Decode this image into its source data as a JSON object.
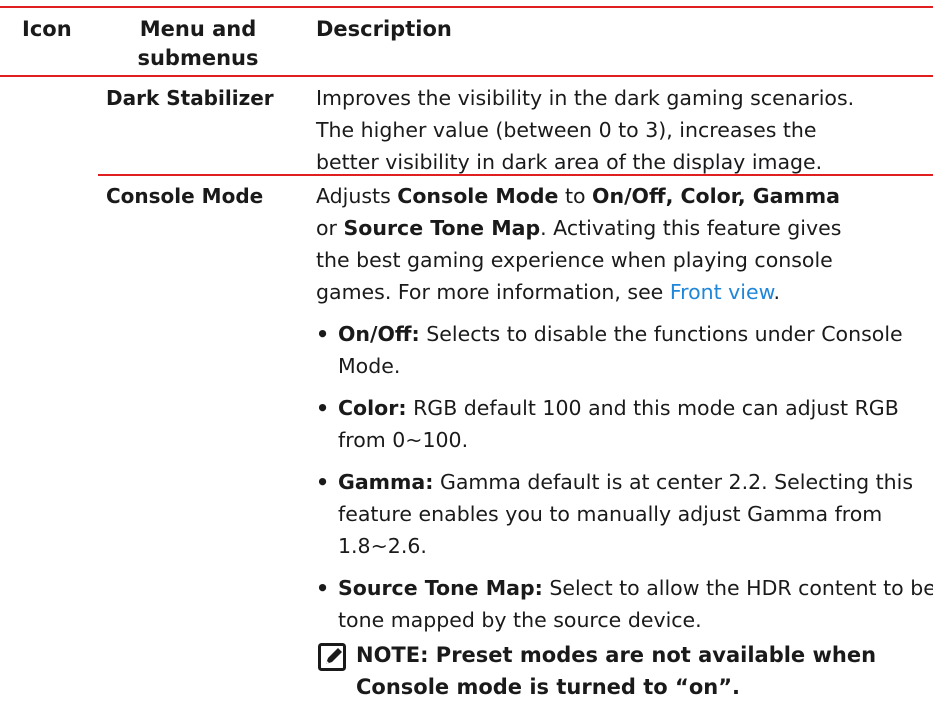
{
  "header": {
    "icon": "Icon",
    "menu_line1": "Menu and",
    "menu_line2": "submenus",
    "description": "Description"
  },
  "rows": [
    {
      "menu": "Dark Stabilizer",
      "desc_lines": [
        "Improves the visibility in the dark gaming scenarios.",
        "The higher value (between 0 to 3), increases the",
        "better visibility in dark area of the display image."
      ]
    },
    {
      "menu": "Console Mode",
      "intro": {
        "p1": "Adjusts ",
        "b1": "Console Mode",
        "p2": " to ",
        "b2": "On/Off, Color, Gamma",
        "p3": "or ",
        "b3": "Source Tone Map",
        "p4": ". Activating this feature gives",
        "p5": "the best gaming experience when playing console",
        "p6": "games. For more information, see ",
        "link": "Front view",
        "p7": "."
      },
      "bullets": [
        {
          "label": "On/Off:",
          "text": " Selects to disable the functions under Console Mode."
        },
        {
          "label": "Color:",
          "text": " RGB default 100 and this mode can adjust RGB from 0~100."
        },
        {
          "label": "Gamma:",
          "text": " Gamma default is at center 2.2. Selecting this feature enables you to manually adjust Gamma from 1.8~2.6."
        },
        {
          "label": "Source Tone Map:",
          "text": " Select to allow the HDR content to be tone mapped by the source device."
        }
      ],
      "note": {
        "icon": "pencil-note-icon",
        "line1": "NOTE: Preset modes are not available when",
        "line2": "Console mode is turned to “on”."
      }
    }
  ],
  "colors": {
    "rule": "#e02020",
    "link": "#1f86d8"
  }
}
